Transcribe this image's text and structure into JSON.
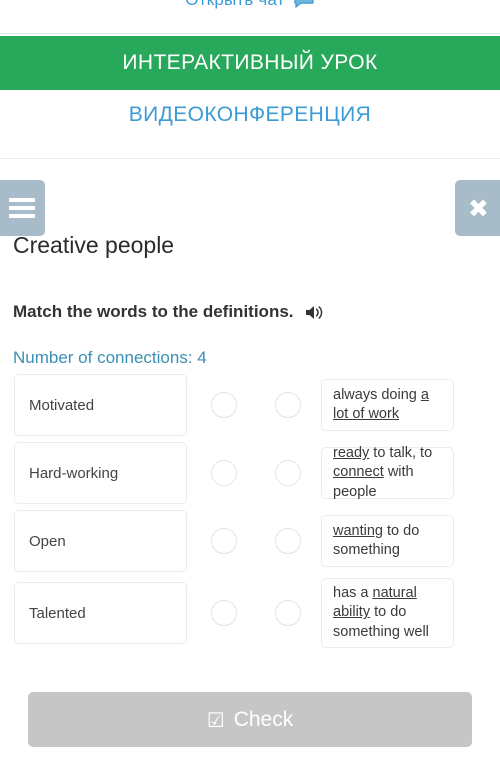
{
  "topbar": {
    "chat_label": "Открыть чат",
    "chat_icon": "chat-bubble-icon"
  },
  "banner": {
    "main_label": "ИНТЕРАКТИВНЫЙ УРОК",
    "sub_label": "ВИДЕОКОНФЕРЕНЦИЯ",
    "green": "#28a85a",
    "blue": "#3b9bd4"
  },
  "controls": {
    "menu_icon": "hamburger-menu-icon",
    "close_icon": "close-x-icon",
    "button_color": "#a7bcc8"
  },
  "lesson": {
    "title": "Creative people",
    "instruction": "Match the words to the definitions.",
    "sound_icon": "speaker-icon",
    "connections_label": "Number of connections: 4",
    "connections_count": 4
  },
  "match": {
    "words": [
      {
        "label": "Motivated"
      },
      {
        "label": "Hard-working"
      },
      {
        "label": "Open"
      },
      {
        "label": "Talented"
      }
    ],
    "definitions": [
      {
        "html": "always doing <u>a lot of work</u>",
        "text": "always doing a lot of work"
      },
      {
        "html": "<u>ready</u> to talk, to <u>connect</u> with people",
        "text": "ready to talk, to connect with people"
      },
      {
        "html": "<u>wanting</u> to do something",
        "text": "wanting to do something"
      },
      {
        "html": "has a <u>natural ability</u> to do something well",
        "text": "has a natural ability to do something well"
      }
    ]
  },
  "footer": {
    "check_label": "Check",
    "check_icon": "checkbox-checked-icon",
    "check_color": "#c6c6c6"
  }
}
